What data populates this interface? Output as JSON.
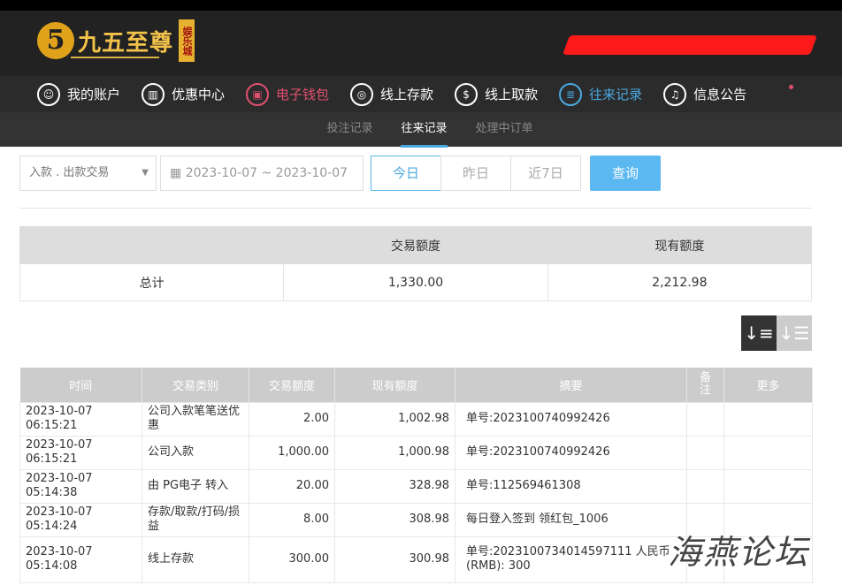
{
  "brand": {
    "name": "九五至尊",
    "badge": "娱乐城",
    "mark": "5"
  },
  "nav": [
    {
      "label": "我的账户",
      "icon": "user-icon"
    },
    {
      "label": "优惠中心",
      "icon": "gift-icon"
    },
    {
      "label": "电子钱包",
      "icon": "wallet-icon"
    },
    {
      "label": "线上存款",
      "icon": "deposit-icon"
    },
    {
      "label": "线上取款",
      "icon": "withdraw-icon"
    },
    {
      "label": "往来记录",
      "icon": "records-icon"
    },
    {
      "label": "信息公告",
      "icon": "bell-icon"
    }
  ],
  "subnav": [
    "投注记录",
    "往来记录",
    "处理中订单"
  ],
  "filter": {
    "type": "入款 . 出款交易",
    "date_range": "2023-10-07 ~ 2023-10-07",
    "today": "今日",
    "yesterday": "昨日",
    "last7": "近7日",
    "query": "查询"
  },
  "summary": {
    "headers": [
      "",
      "交易额度",
      "现有额度"
    ],
    "label": "总计",
    "amount": "1,330.00",
    "balance": "2,212.98"
  },
  "table": {
    "headers": [
      "时间",
      "交易类别",
      "交易额度",
      "现有额度",
      "摘要",
      "备注",
      "更多"
    ],
    "rows": [
      [
        "2023-10-07 06:15:21",
        "公司入款笔笔送优惠",
        "2.00",
        "1,002.98",
        "单号:2023100740992426"
      ],
      [
        "2023-10-07 06:15:21",
        "公司入款",
        "1,000.00",
        "1,000.98",
        "单号:2023100740992426"
      ],
      [
        "2023-10-07 05:14:38",
        "由 PG电子 转入",
        "20.00",
        "328.98",
        "单号:112569461308"
      ],
      [
        "2023-10-07 05:14:24",
        "存款/取款/打码/损益",
        "8.00",
        "308.98",
        "每日登入签到 领红包_1006"
      ],
      [
        "2023-10-07 05:14:08",
        "线上存款",
        "300.00",
        "300.98",
        "单号:2023100734014597111 人民币(RMB): 300"
      ]
    ]
  },
  "watermark": "海燕论坛"
}
